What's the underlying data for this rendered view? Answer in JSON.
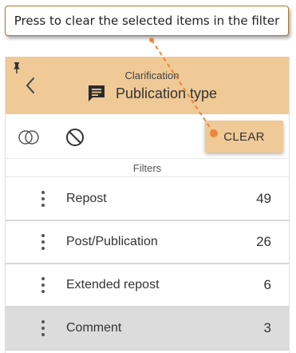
{
  "tooltip": {
    "text": "Press to clear the selected items in the filter"
  },
  "header": {
    "kicker": "Clarification",
    "title": "Publication type"
  },
  "toolbar": {
    "clear_label": "CLEAR"
  },
  "filters": {
    "label": "Filters"
  },
  "items": [
    {
      "label": "Repost",
      "count": "49",
      "selected": false
    },
    {
      "label": "Post/Publication",
      "count": "26",
      "selected": false
    },
    {
      "label": "Extended repost",
      "count": "6",
      "selected": false
    },
    {
      "label": "Comment",
      "count": "3",
      "selected": true
    }
  ],
  "colors": {
    "accent": "#efc996",
    "pointer": "#e8883a",
    "selected_row": "#dcdcdc"
  },
  "icons": [
    "pin-icon",
    "back-icon",
    "message-icon",
    "overlap-icon",
    "block-icon",
    "kebab-icon"
  ]
}
